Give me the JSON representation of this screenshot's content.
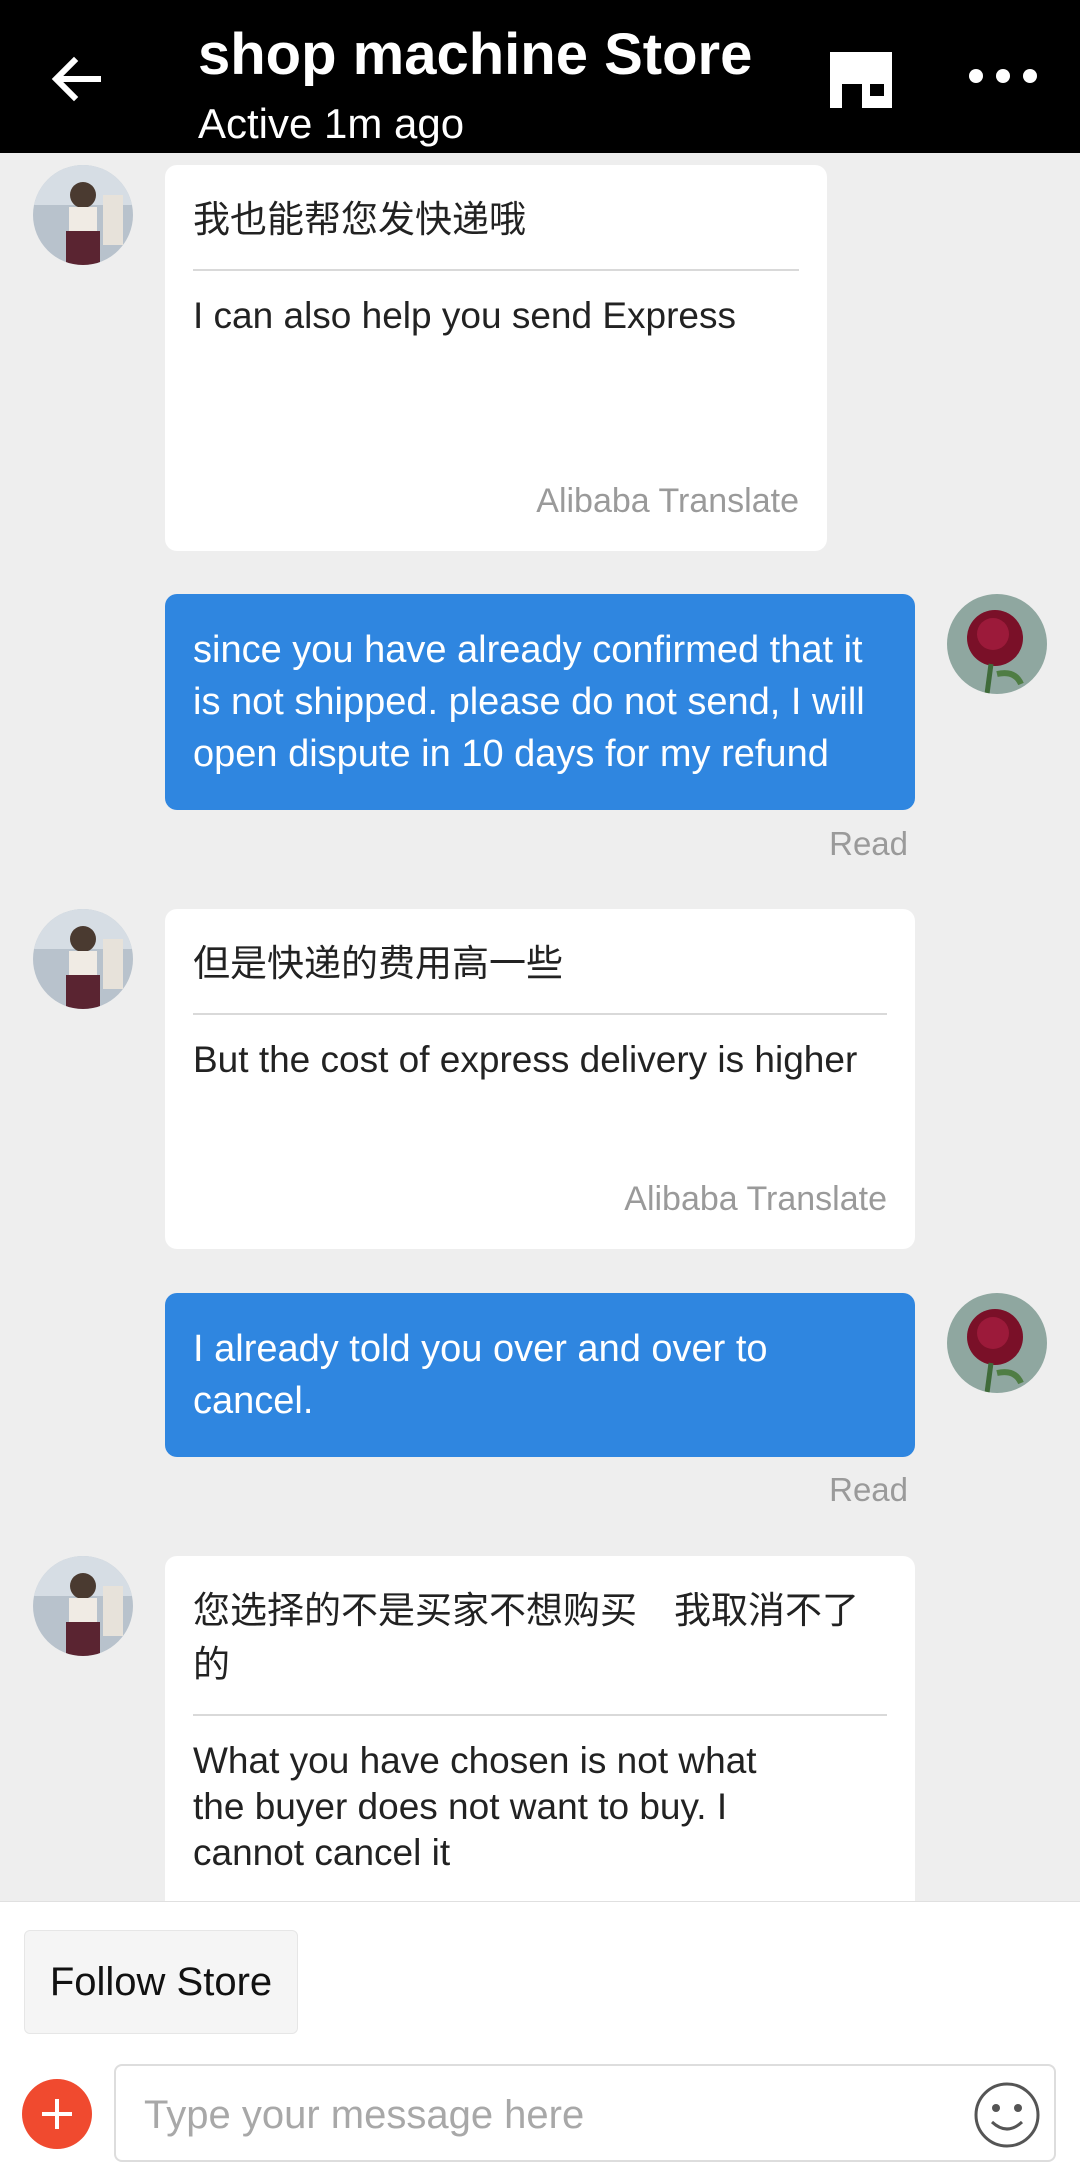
{
  "header": {
    "title": "shop machine Store",
    "status": "Active 1m ago",
    "icons": {
      "back": "back-arrow-icon",
      "store": "store-icon",
      "more": "more-icon"
    }
  },
  "messages": [
    {
      "direction": "in",
      "original": "我也能帮您发快递哦",
      "translation": "I can also help you send Express",
      "source": "Alibaba Translate"
    },
    {
      "direction": "out",
      "text": "since you have already confirmed that it is not shipped. please do not send, I will open dispute in 10 days for my refund",
      "status": "Read"
    },
    {
      "direction": "in",
      "original": "但是快递的费用高一些",
      "translation": "But the cost of express delivery is higher",
      "source": "Alibaba Translate"
    },
    {
      "direction": "out",
      "text": "I already told you over and over to cancel.",
      "status": "Read"
    },
    {
      "direction": "in",
      "original": "您选择的不是买家不想购买　我取消不了的",
      "translation": "What you have chosen is not what the buyer does not want to buy. I cannot cancel it"
    }
  ],
  "bottom": {
    "follow_label": "Follow Store",
    "input_placeholder": "Type your message here",
    "icons": {
      "add": "plus-icon",
      "emoji": "emoji-icon"
    }
  },
  "colors": {
    "header_bg": "#000000",
    "outgoing_bubble": "#2f86e0",
    "add_button": "#f04a2f",
    "chat_bg": "#eeeeee"
  }
}
